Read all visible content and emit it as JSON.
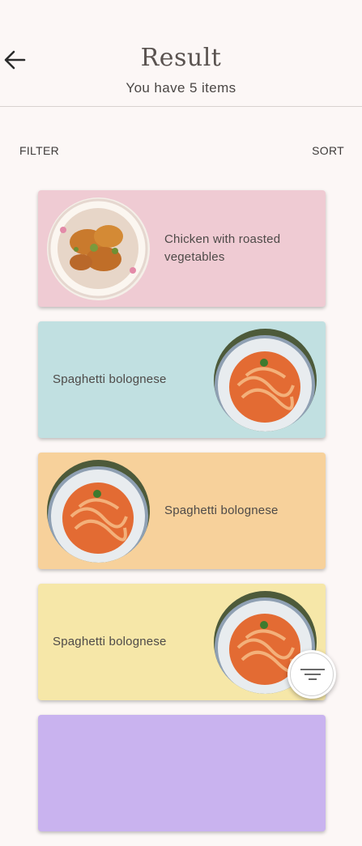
{
  "header": {
    "title": "Result",
    "subtitle": "You have 5 items"
  },
  "toolbar": {
    "filter_label": "FILTER",
    "sort_label": "SORT"
  },
  "items": [
    {
      "name": "Chicken with roasted vegetables",
      "color": "#efcbd3",
      "image": "chicken-dish",
      "image_side": "left"
    },
    {
      "name": "Spaghetti bolognese",
      "color": "#c1e0e1",
      "image": "spaghetti-dish",
      "image_side": "right"
    },
    {
      "name": "Spaghetti bolognese",
      "color": "#f7d19b",
      "image": "spaghetti-dish",
      "image_side": "left"
    },
    {
      "name": "Spaghetti bolognese",
      "color": "#f6e7a8",
      "image": "spaghetti-dish",
      "image_side": "right"
    },
    {
      "color": "#c9b3ef"
    }
  ],
  "colors": {
    "background": "#fcf7f6",
    "text": "#4e4a48"
  },
  "icons": {
    "back": "arrow-left-icon",
    "fab": "filter-lines-icon"
  }
}
